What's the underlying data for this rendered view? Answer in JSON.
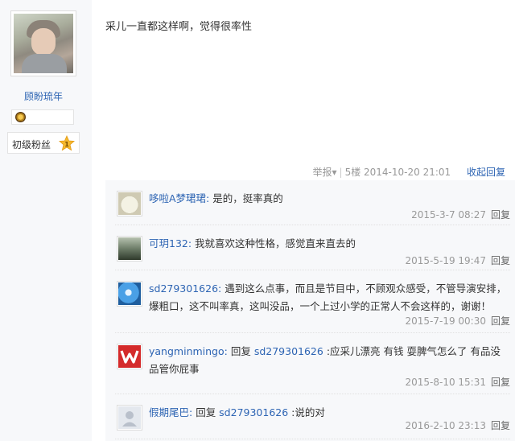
{
  "user": {
    "name": "顾盼琉年",
    "level_label": "初级粉丝",
    "level_number": "1"
  },
  "post": {
    "text": "采儿一直都这样啊，觉得很率性",
    "report_label": "举报",
    "report_arrow": "▾",
    "floor_time": "5楼 2014-10-20 21:01",
    "collapse_label": "收起回复"
  },
  "replies": [
    {
      "name": "哆啦A梦珺珺:",
      "text": " 是的，挺率真的",
      "time": "2015-3-7 08:27",
      "reply_label": "回复",
      "avatar_color": "#e3e0d2"
    },
    {
      "name": "可玥132:",
      "text": " 我就喜欢这种性格，感觉直来直去的",
      "time": "2015-5-19 19:47",
      "reply_label": "回复",
      "avatar_color": "#5a6b55"
    },
    {
      "name": "sd279301626:",
      "text": " 遇到这么点事，而且是节目中，不顾观众感受，不管导演安排，爆粗口，这不叫率真，这叫没品，一个上过小学的正常人不会这样的，谢谢！",
      "time": "2015-7-19 00:30",
      "reply_label": "回复",
      "avatar_color": "#3e8fd8"
    },
    {
      "name": "yangminmingo:",
      "prefix": " 回复 ",
      "link": "sd279301626",
      "text": " :应采儿漂亮 有钱 耍脾气怎么了 有品没品管你屁事",
      "time": "2015-8-10 15:31",
      "reply_label": "回复",
      "avatar_color": "#d42a2a"
    },
    {
      "name": "假期尾巴:",
      "prefix": " 回复 ",
      "link": "sd279301626",
      "text": " :说的对",
      "time": "2016-2-10 23:13",
      "reply_label": "回复",
      "avatar_color": "#dfe3ea"
    }
  ]
}
